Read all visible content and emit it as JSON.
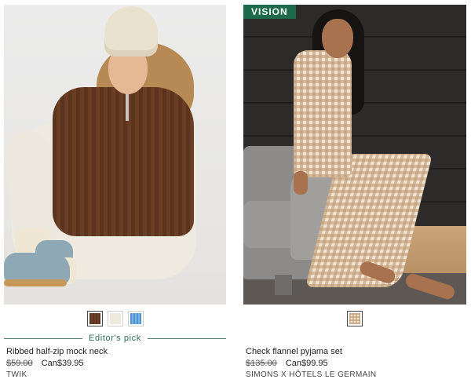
{
  "products": [
    {
      "badge": "",
      "swatches": [
        {
          "color": "#5b341f",
          "selected": true
        },
        {
          "color": "#efe9dd",
          "selected": false
        },
        {
          "color": "#5d9fd6",
          "selected": false
        }
      ],
      "editors_pick": "Editor's pick",
      "name": "Ribbed half-zip mock neck",
      "old_price": "$59.00",
      "new_price": "Can$39.95",
      "brand": "TWIK"
    },
    {
      "badge": "VISION",
      "swatches": [
        {
          "color": "#f1e4d3",
          "selected": true
        }
      ],
      "editors_pick": "",
      "name": "Check flannel pyjama set",
      "old_price": "$135.00",
      "new_price": "Can$99.95",
      "brand": "SIMONS X HÔTELS LE GERMAIN"
    }
  ]
}
